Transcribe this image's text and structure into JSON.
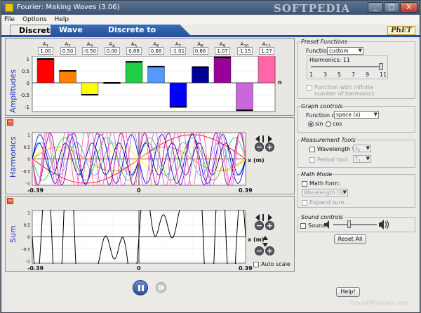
{
  "window": {
    "title": "Fourier: Making Waves (3.06)",
    "watermark": "SOFTPEDIA",
    "footer_watermark": "Crack4Windows.com",
    "min": "_",
    "max": "□",
    "close": "X"
  },
  "menu": [
    "File",
    "Options",
    "Help"
  ],
  "tabs": [
    "Discrete",
    "Wave Game",
    "Discrete to Continuous"
  ],
  "phet_logo": "PhET",
  "amplitudes": {
    "label": "Amplitudes",
    "n_label": "n",
    "y_ticks": [
      "1",
      "0.5",
      "0",
      "-0.5",
      "-1"
    ],
    "harmonics": [
      {
        "label": "A",
        "sub": "1",
        "value": "1.00",
        "num": 1.0,
        "color": "#ff0000"
      },
      {
        "label": "A",
        "sub": "2",
        "value": "0.50",
        "num": 0.5,
        "color": "#ff8000"
      },
      {
        "label": "A",
        "sub": "3",
        "value": "-0.50",
        "num": -0.5,
        "color": "#ffff00"
      },
      {
        "label": "A",
        "sub": "4",
        "value": "0.00",
        "num": 0.0,
        "color": "#8b4513"
      },
      {
        "label": "A",
        "sub": "5",
        "value": "0.88",
        "num": 0.88,
        "color": "#22cc44"
      },
      {
        "label": "A",
        "sub": "6",
        "value": "0.68",
        "num": 0.68,
        "color": "#5599ff"
      },
      {
        "label": "A",
        "sub": "7",
        "value": "-1.01",
        "num": -1.01,
        "color": "#0000ff"
      },
      {
        "label": "A",
        "sub": "8",
        "value": "0.66",
        "num": 0.66,
        "color": "#000099"
      },
      {
        "label": "A",
        "sub": "9",
        "value": "1.07",
        "num": 1.07,
        "color": "#990099"
      },
      {
        "label": "A",
        "sub": "10",
        "value": "-1.15",
        "num": -1.15,
        "color": "#cc66dd"
      },
      {
        "label": "A",
        "sub": "11",
        "value": "1.27",
        "num": 1.27,
        "color": "#ff66aa"
      }
    ]
  },
  "harmonics_plot": {
    "label": "Harmonics",
    "x_label": "x (m)",
    "x_left": "-0.39",
    "x_mid": "0",
    "x_right": "0.39",
    "y_ticks": [
      "1",
      "0.5",
      "0",
      "-0.5",
      "-1"
    ],
    "collapse": "−",
    "zoom_out": "−",
    "zoom_in": "+"
  },
  "sum_plot": {
    "label": "Sum",
    "x_label": "x (m)",
    "x_left": "-0.39",
    "x_mid": "0",
    "x_right": "0.39",
    "y_ticks": [
      "1",
      "0.5",
      "0",
      "-0.5",
      "-1"
    ],
    "auto_scale": "Auto scale",
    "collapse": "−",
    "zoom_out": "−",
    "zoom_in": "+"
  },
  "preset": {
    "title": "Preset Functions",
    "function_label": "Function:",
    "function_value": "custom",
    "harmonics_label": "Harmonics: 11",
    "harmonics_value": 11,
    "harmonics_max": 11,
    "slider_ticks": [
      "1",
      "3",
      "5",
      "7",
      "9",
      "11"
    ],
    "infinite_label_1": "Function with infinite",
    "infinite_label_2": "number of harmonics"
  },
  "graph_controls": {
    "title": "Graph controls",
    "function_of_label": "Function of:",
    "function_of_value": "space (x)",
    "sin": "sin",
    "cos": "cos"
  },
  "measurement": {
    "title": "Measurement Tools",
    "wavelength_tool": "Wavelength tool:",
    "wavelength_value": "λ",
    "wavelength_sub": "1",
    "period_tool": "Period tool:",
    "period_value": "T",
    "period_sub": "1"
  },
  "math_mode": {
    "title": "Math Mode",
    "math_form": "Math form:",
    "math_form_value": "Wavelength (λ)",
    "expand_sum": "Expand sum..."
  },
  "sound": {
    "title": "Sound controls",
    "sound_label": "Sound",
    "volume_level": 0.35
  },
  "buttons": {
    "reset_all": "Reset All",
    "help": "Help!"
  }
}
